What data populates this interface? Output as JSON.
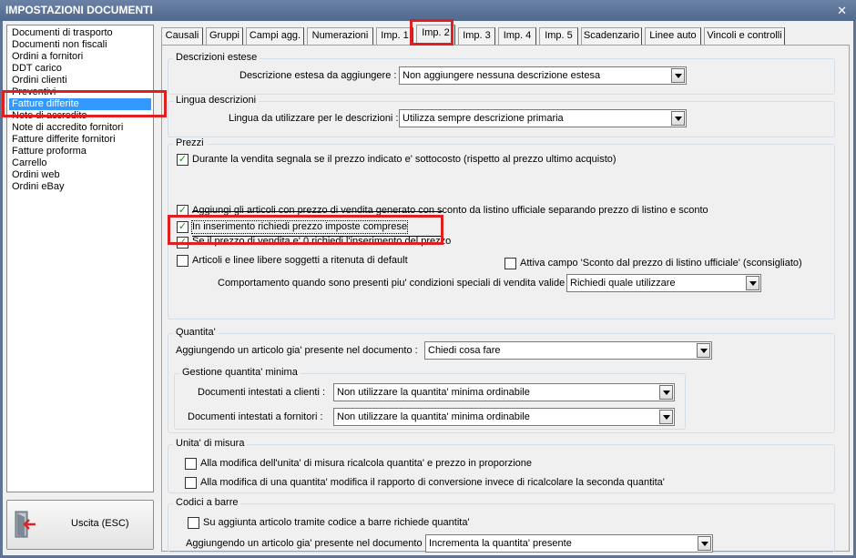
{
  "window": {
    "title": "IMPOSTAZIONI DOCUMENTI",
    "close_glyph": "✕"
  },
  "doc_types": [
    "Documenti di trasporto",
    "Documenti non fiscali",
    "Ordini a fornitori",
    "DDT carico",
    "Ordini clienti",
    "Preventivi",
    "Fatture differite",
    "Note di accredito",
    "Note di accredito fornitori",
    "Fatture differite fornitori",
    "Fatture proforma",
    "Carrello",
    "Ordini web",
    "Ordini eBay"
  ],
  "selected_doc_type": "Fatture differite",
  "exit_button": {
    "label": "Uscita (ESC)",
    "icon": "exit-door-icon"
  },
  "tabs": [
    "Causali",
    "Gruppi",
    "Campi agg.",
    "Numerazioni",
    "Imp. 1",
    "Imp. 2",
    "Imp. 3",
    "Imp. 4",
    "Imp. 5",
    "Scadenzario",
    "Linee auto",
    "Vincoli e controlli"
  ],
  "active_tab": "Imp. 2",
  "descrizioni_estese": {
    "title": "Descrizioni estese",
    "label": "Descrizione estesa da aggiungere :",
    "value": "Non aggiungere nessuna descrizione estesa"
  },
  "lingua_descrizioni": {
    "title": "Lingua descrizioni",
    "label": "Lingua da utilizzare per le descrizioni :",
    "value": "Utilizza sempre descrizione primaria"
  },
  "prezzi": {
    "title": "Prezzi",
    "sottocosto": {
      "label": "Durante la vendita segnala se il prezzo indicato e' sottocosto (rispetto al prezzo ultimo acquisto)",
      "checked": true
    },
    "separa_sconto": {
      "label": "Aggiungi gli articoli con prezzo di vendita generato con sconto da listino ufficiale separando prezzo di listino e sconto",
      "checked": true
    },
    "prezzo_imposte": {
      "label": "In inserimento richiedi prezzo imposte comprese",
      "checked": true
    },
    "prezzo_zero": {
      "label": "Se il prezzo di vendita e' 0 richiedi l'inserimento del prezzo",
      "checked": true
    },
    "ritenuta": {
      "label": "Articoli e linee libere soggetti a ritenuta di default",
      "checked": false
    },
    "sconto_listino": {
      "label": "Attiva campo 'Sconto dal prezzo di listino ufficiale' (sconsigliato)",
      "checked": false
    },
    "condizioni_label": "Comportamento quando sono presenti piu' condizioni speciali di vendita valide :",
    "condizioni_value": "Richiedi quale utilizzare"
  },
  "quantita": {
    "title": "Quantita'",
    "label": "Aggiungendo un articolo gia' presente nel documento :",
    "value": "Chiedi cosa fare",
    "minima": {
      "title": "Gestione quantita' minima",
      "clienti_label": "Documenti intestati a clienti :",
      "clienti_value": "Non utilizzare la quantita' minima ordinabile",
      "fornitori_label": "Documenti intestati a fornitori :",
      "fornitori_value": "Non utilizzare la quantita' minima ordinabile"
    }
  },
  "unita_misura": {
    "title": "Unita' di misura",
    "ricalcola": {
      "label": "Alla modifica dell'unita' di misura ricalcola quantita' e prezzo in proporzione",
      "checked": false
    },
    "rapporto": {
      "label": "Alla modifica di una quantita' modifica il rapporto di conversione invece di ricalcolare la seconda quantita'",
      "checked": false
    }
  },
  "codici_barre": {
    "title": "Codici a barre",
    "richiedi_qta": {
      "label": "Su aggiunta articolo tramite codice a barre richiede quantita'",
      "checked": false
    },
    "label": "Aggiungendo un articolo gia' presente nel documento :",
    "value": "Incrementa la quantita' presente"
  },
  "colors": {
    "highlight": "#e02020",
    "selection": "#3399ff",
    "titlebar": "#5f7394",
    "check": "#1e8a1e"
  }
}
